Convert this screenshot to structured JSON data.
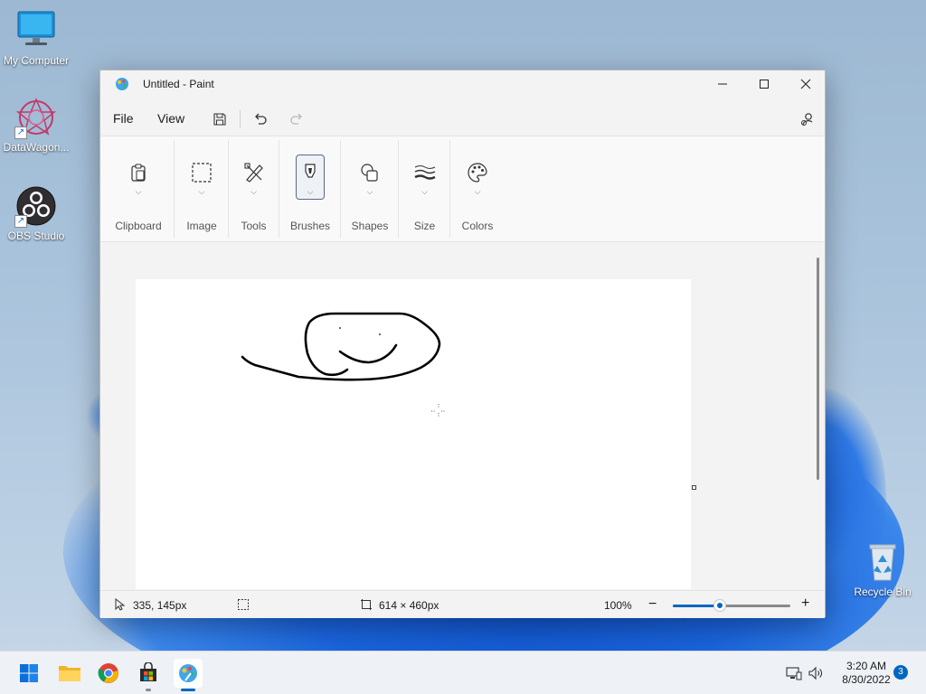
{
  "desktop": {
    "icons": [
      {
        "label": "My Computer",
        "icon": "monitor-icon"
      },
      {
        "label": "DataWagon...",
        "icon": "datawagon-icon"
      },
      {
        "label": "OBS Studio",
        "icon": "obs-icon"
      },
      {
        "label": "Recycle Bin",
        "icon": "recycle-bin-icon"
      }
    ]
  },
  "window": {
    "title": "Untitled - Paint",
    "menu": {
      "file": "File",
      "view": "View"
    },
    "ribbon": {
      "groups": [
        {
          "label": "Clipboard",
          "icon": "clipboard-icon"
        },
        {
          "label": "Image",
          "icon": "selection-icon"
        },
        {
          "label": "Tools",
          "icon": "tools-icon"
        },
        {
          "label": "Brushes",
          "icon": "brush-icon"
        },
        {
          "label": "Shapes",
          "icon": "shapes-icon"
        },
        {
          "label": "Size",
          "icon": "size-icon"
        },
        {
          "label": "Colors",
          "icon": "palette-icon"
        }
      ]
    },
    "status": {
      "cursor_position": "335, 145px",
      "canvas_size": "614 × 460px",
      "zoom": "100%",
      "zoom_fraction": 0.4
    }
  },
  "taskbar": {
    "apps": [
      "start-icon",
      "file-explorer-icon",
      "chrome-icon",
      "store-icon",
      "paint-icon"
    ],
    "time": "3:20 AM",
    "date": "8/30/2022",
    "notification_count": "3"
  },
  "colors": {
    "accent": "#0067c0",
    "window_bg": "#f3f3f3"
  }
}
